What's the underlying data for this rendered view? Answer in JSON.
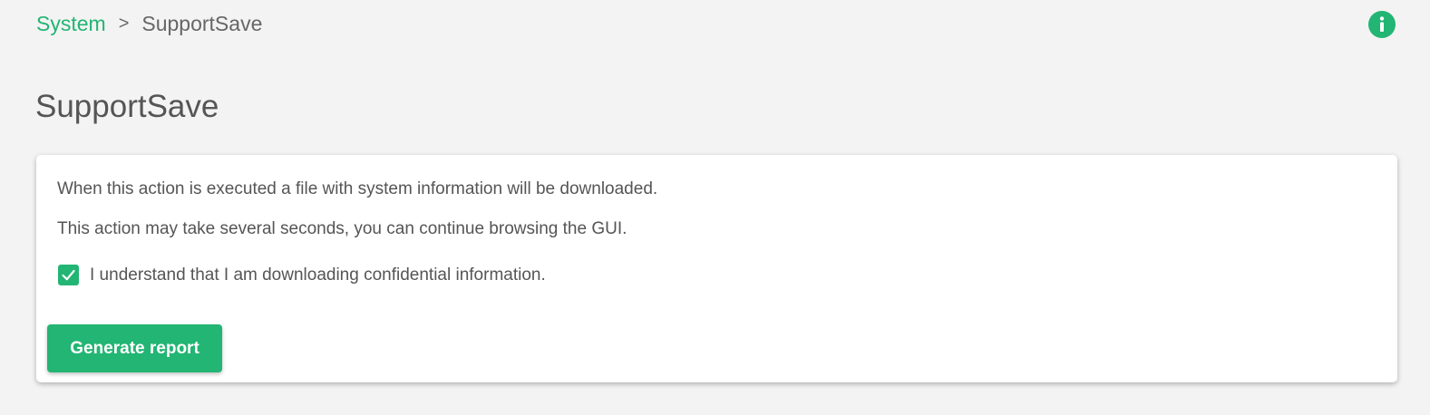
{
  "breadcrumb": {
    "parent": "System",
    "separator": ">",
    "current": "SupportSave"
  },
  "header": {
    "info_icon": "info-icon"
  },
  "page_title": "SupportSave",
  "card": {
    "paragraph_1": "When this action is executed a file with system information will be downloaded.",
    "paragraph_2": "This action may take several seconds, you can continue browsing the GUI.",
    "confirm_checkbox": {
      "checked": true,
      "label": "I understand that I am downloading confidential information."
    },
    "generate_button_label": "Generate report"
  },
  "colors": {
    "accent": "#22b573",
    "background": "#f3f3f3",
    "card": "#ffffff",
    "text": "#555555"
  }
}
